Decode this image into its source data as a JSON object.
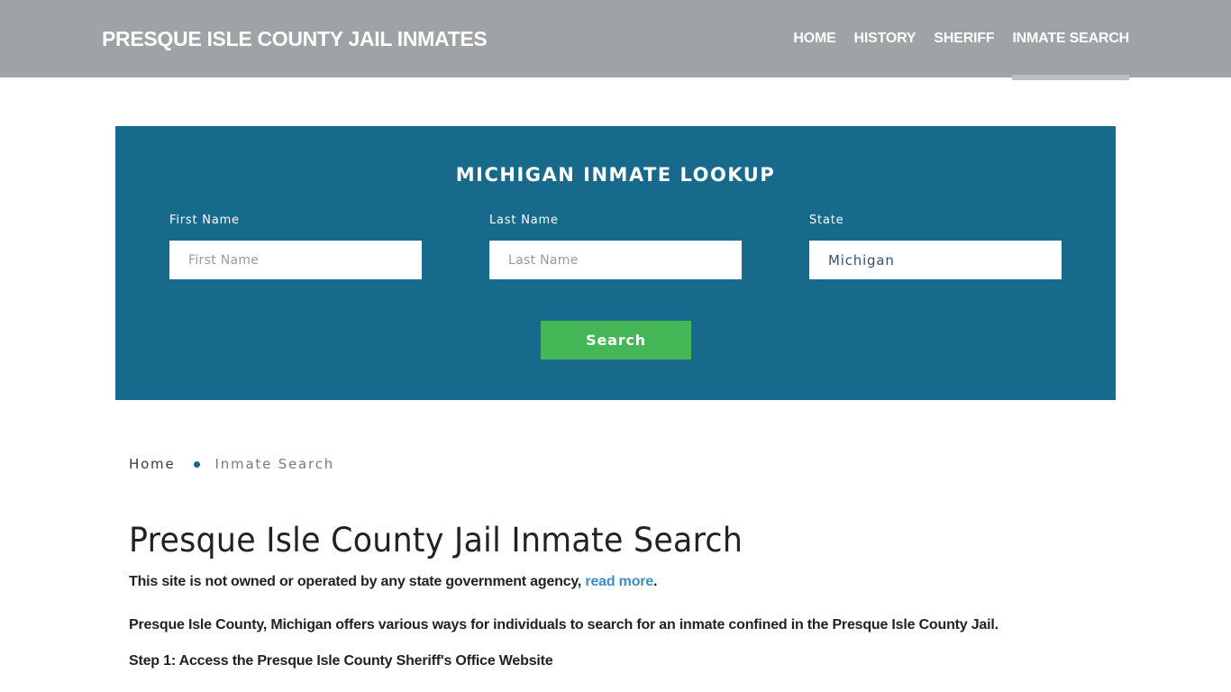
{
  "header": {
    "brand": "PRESQUE ISLE COUNTY JAIL INMATES",
    "nav": [
      {
        "label": "HOME",
        "active": false
      },
      {
        "label": "HISTORY",
        "active": false
      },
      {
        "label": "SHERIFF",
        "active": false
      },
      {
        "label": "INMATE SEARCH",
        "active": true
      }
    ]
  },
  "search_panel": {
    "title": "MICHIGAN INMATE LOOKUP",
    "fields": {
      "first_name": {
        "label": "First Name",
        "placeholder": "First Name",
        "value": ""
      },
      "last_name": {
        "label": "Last Name",
        "placeholder": "Last Name",
        "value": ""
      },
      "state": {
        "label": "State",
        "value": "Michigan"
      }
    },
    "search_button": "Search"
  },
  "breadcrumb": {
    "home": "Home",
    "current": "Inmate Search"
  },
  "content": {
    "title": "Presque Isle County Jail Inmate Search",
    "disclaimer_text": "This site is not owned or operated by any state government agency, ",
    "disclaimer_link": "read more",
    "disclaimer_end": ".",
    "intro": "Presque Isle County, Michigan offers various ways for individuals to search for an inmate confined in the Presque Isle County Jail.",
    "step1_heading": "Step 1: Access the Presque Isle County Sheriff's Office Website"
  },
  "colors": {
    "header_bg": "#9ea3a6",
    "panel_bg": "#176a8c",
    "button_bg": "#45b757",
    "link": "#3b8fc7"
  }
}
